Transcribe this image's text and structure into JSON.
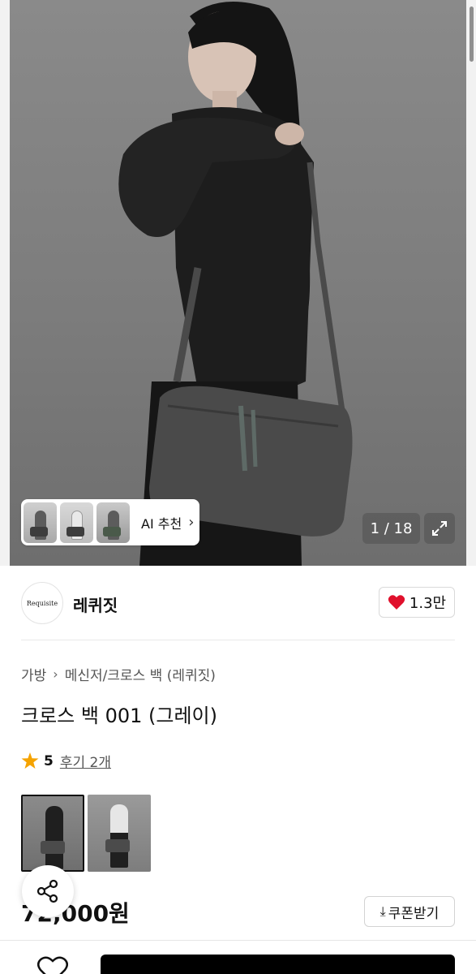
{
  "gallery": {
    "ai_recommend_label": "AI 추천",
    "page_counter": "1 / 18"
  },
  "brand": {
    "logo_text": "Requisite",
    "name": "레퀴짓",
    "like_count": "1.3만"
  },
  "breadcrumb": {
    "category": "가방",
    "subcategory": "메신저/크로스 백 (레퀴짓)"
  },
  "product": {
    "title": "크로스 백 001 (그레이)",
    "rating": "5",
    "reviews": "후기 2개",
    "price": "72,000원",
    "coupon_label": "쿠폰받기"
  },
  "colors": {
    "accent_red": "#e0102c",
    "star": "#f5a300",
    "primary_button": "#000000"
  }
}
